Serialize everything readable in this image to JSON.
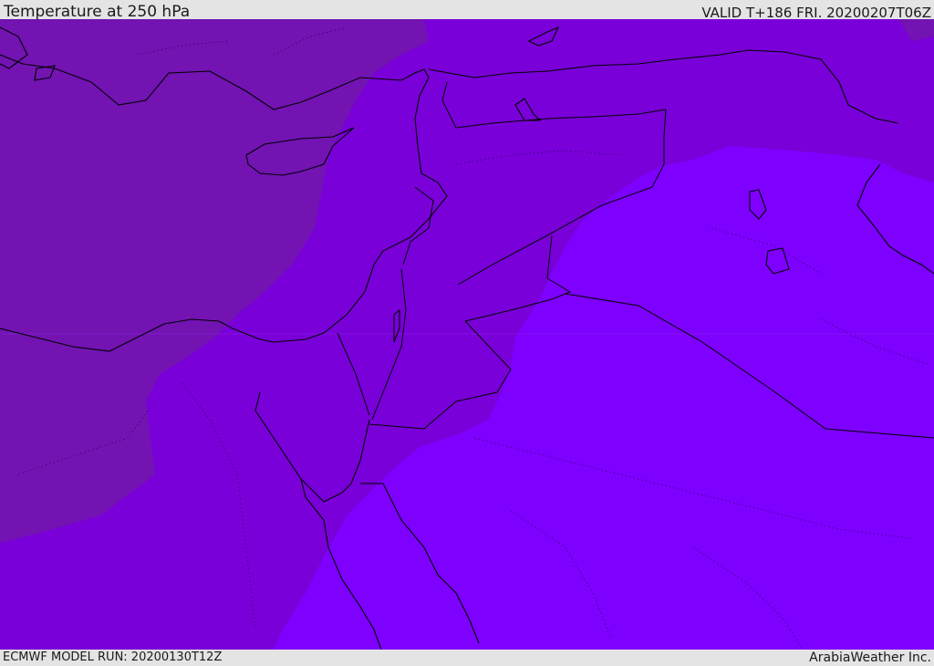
{
  "header": {
    "title": "Temperature at 250 hPa",
    "valid_time": "VALID T+186 FRI. 20200207T06Z"
  },
  "footer": {
    "model_run": "ECMWF MODEL RUN: 20200130T12Z",
    "credit": "ArabiaWeather Inc."
  },
  "map": {
    "field": "temperature",
    "level": "250 hPa",
    "region": "Eastern Mediterranean / Middle East",
    "colors": {
      "warmest_zone": "#7213b2",
      "middle_zone": "#7900d8",
      "coldest_zone": "#7e00fe",
      "coastline": "#000000",
      "borders": "#000000"
    }
  }
}
